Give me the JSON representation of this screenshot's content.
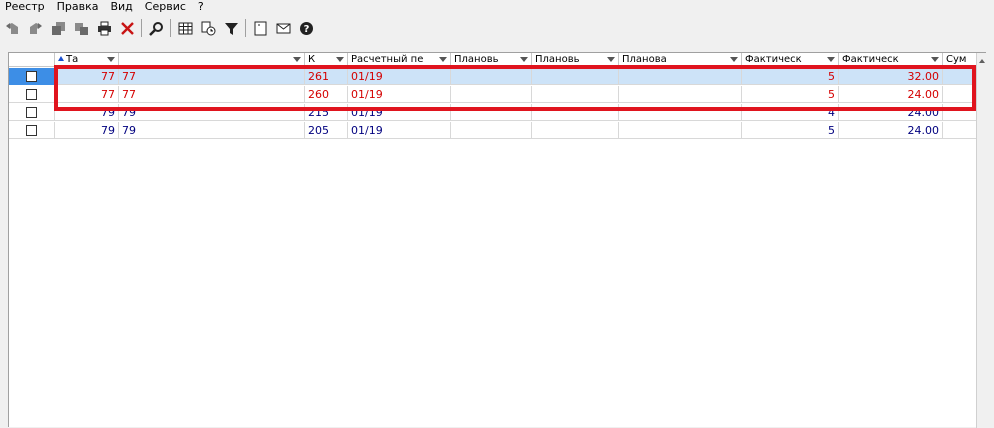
{
  "menu": [
    "Реестр",
    "Правка",
    "Вид",
    "Сервис",
    "?"
  ],
  "toolbar": {
    "icons": [
      "copy-back-icon",
      "copy-forward-icon",
      "stack-icon",
      "duplicate-icon",
      "print-icon",
      "delete-icon",
      "search-icon",
      "table-icon",
      "clock-icon",
      "filter-icon",
      "document-icon",
      "mail-icon",
      "help-icon"
    ]
  },
  "grid": {
    "columns": [
      "",
      "Та",
      "",
      "К",
      "Расчетный пе",
      "Плановь",
      "Плановь",
      "Планова",
      "Фактическ",
      "Фактическ",
      "Сум"
    ],
    "rows": [
      {
        "c1": "77",
        "c2": "77",
        "c3": "261",
        "c4": "01/19",
        "c5": "",
        "c6": "",
        "c7": "",
        "c8": "5",
        "c9": "32.00",
        "c10": ""
      },
      {
        "c1": "77",
        "c2": "77",
        "c3": "260",
        "c4": "01/19",
        "c5": "",
        "c6": "",
        "c7": "",
        "c8": "5",
        "c9": "24.00",
        "c10": ""
      },
      {
        "c1": "79",
        "c2": "79",
        "c3": "215",
        "c4": "01/19",
        "c5": "",
        "c6": "",
        "c7": "",
        "c8": "4",
        "c9": "24.00",
        "c10": ""
      },
      {
        "c1": "79",
        "c2": "79",
        "c3": "205",
        "c4": "01/19",
        "c5": "",
        "c6": "",
        "c7": "",
        "c8": "5",
        "c9": "24.00",
        "c10": ""
      }
    ]
  },
  "colors": {
    "red_text": "#d40000",
    "blue_text": "#00007f",
    "selection": "#cde3f8",
    "highlight": "#e0141e"
  }
}
